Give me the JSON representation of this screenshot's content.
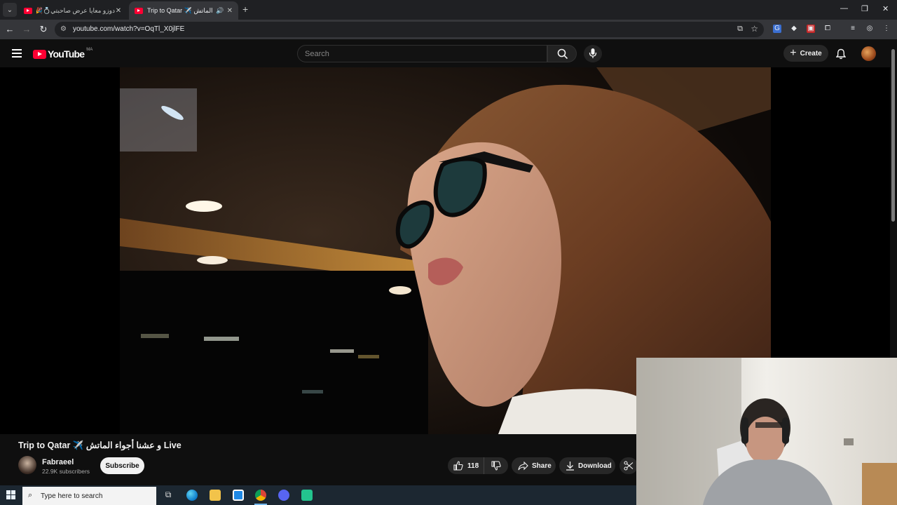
{
  "browser": {
    "tabs": [
      {
        "title": "دوزو معايا عرض صاحبتي💍🎉 جيت",
        "active": false
      },
      {
        "title": "Trip to Qatar ✈️ و عشنا أجواء الماتش",
        "active": true
      }
    ],
    "url": "youtube.com/watch?v=OqTl_X0jlFE"
  },
  "youtube": {
    "logo_text": "YouTube",
    "country_code": "MA",
    "search_placeholder": "Search",
    "create_label": "Create"
  },
  "video": {
    "title": "Trip to Qatar ✈️ و عشنا أجواء الماتش Live",
    "channel_name": "Fabraeel",
    "subscribers": "22.9K subscribers",
    "subscribe_label": "Subscribe",
    "like_count": "118",
    "share_label": "Share",
    "download_label": "Download"
  },
  "taskbar": {
    "search_placeholder": "Type here to search"
  },
  "colors": {
    "youtube_red": "#ff0033",
    "page_bg": "#0f0f0f",
    "pill_bg": "#272727"
  }
}
